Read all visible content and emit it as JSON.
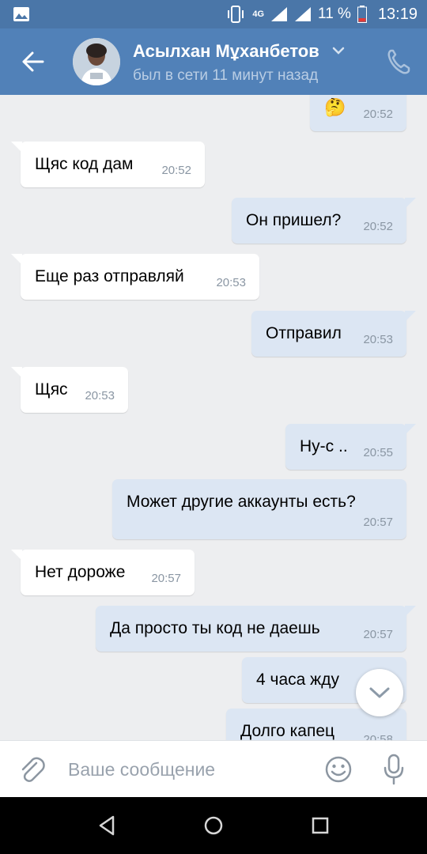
{
  "status_bar": {
    "network": "4G",
    "battery": "11 %",
    "time": "13:19"
  },
  "header": {
    "back_icon": "arrow-left-icon",
    "contact_name": "Асылхан Мұханбетов",
    "last_seen": "был в сети 11 минут назад",
    "call_icon": "phone-icon"
  },
  "messages": [
    {
      "dir": "out",
      "text": "🤔",
      "time": "20:52"
    },
    {
      "dir": "in",
      "text": "Щяс код дам",
      "time": "20:52"
    },
    {
      "dir": "out",
      "text": "Он пришел?",
      "time": "20:52"
    },
    {
      "dir": "in",
      "text": "Еще раз отправляй",
      "time": "20:53"
    },
    {
      "dir": "out",
      "text": "Отправил",
      "time": "20:53"
    },
    {
      "dir": "in",
      "text": "Щяс",
      "time": "20:53"
    },
    {
      "dir": "out",
      "text": "Ну-с ..",
      "time": "20:55"
    },
    {
      "dir": "out",
      "text": "Может другие аккаунты есть?",
      "time": "20:57"
    },
    {
      "dir": "in",
      "text": "Нет дороже",
      "time": "20:57"
    },
    {
      "dir": "out",
      "text": "Да просто ты код не даешь",
      "time": "20:57"
    },
    {
      "dir": "out",
      "text": "4 часа жду",
      "time": ""
    },
    {
      "dir": "out",
      "text": "Долго капец",
      "time": "20:58"
    }
  ],
  "composer": {
    "placeholder": "Ваше сообщение",
    "attach_icon": "paperclip-icon",
    "emoji_icon": "smiley-icon",
    "mic_icon": "microphone-icon"
  },
  "colors": {
    "header_bg": "#5181b8",
    "status_bg": "#4a76a8",
    "chat_bg": "#edeef0",
    "incoming_bubble": "#ffffff",
    "outgoing_bubble": "#dce6f3"
  }
}
